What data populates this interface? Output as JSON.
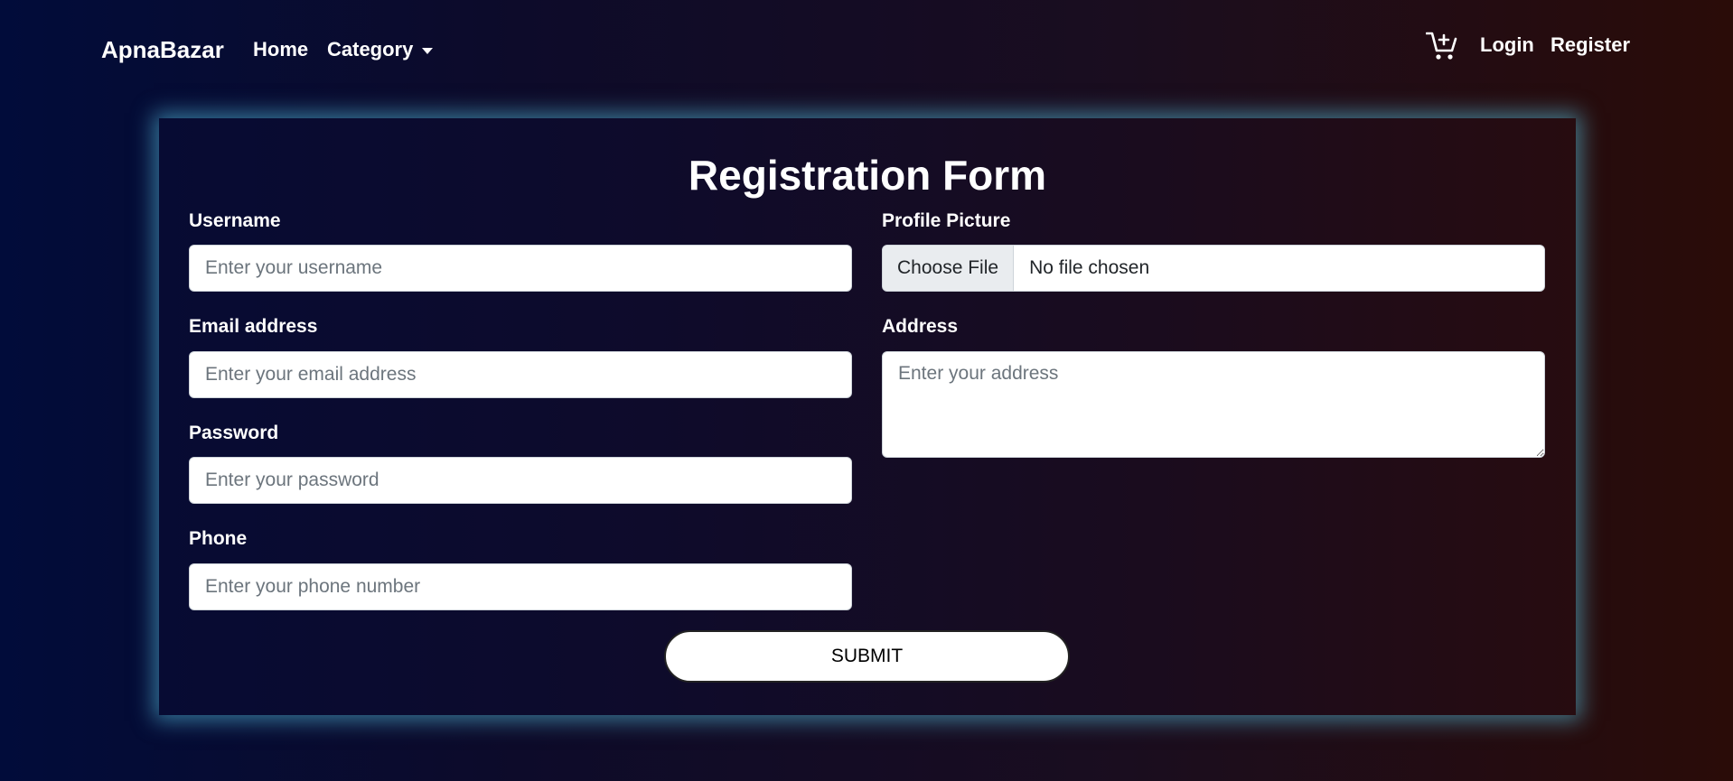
{
  "navbar": {
    "brand": "ApnaBazar",
    "home": "Home",
    "category": "Category",
    "login": "Login",
    "register": "Register",
    "cart_icon": "cart-plus-icon"
  },
  "form": {
    "title": "Registration Form",
    "username": {
      "label": "Username",
      "placeholder": "Enter your username"
    },
    "email": {
      "label": "Email address",
      "placeholder": "Enter your email address"
    },
    "password": {
      "label": "Password",
      "placeholder": "Enter your password"
    },
    "phone": {
      "label": "Phone",
      "placeholder": "Enter your phone number"
    },
    "profile_picture": {
      "label": "Profile Picture",
      "button": "Choose File",
      "status": "No file chosen"
    },
    "address": {
      "label": "Address",
      "placeholder": "Enter your address"
    },
    "submit": "SUBMIT"
  },
  "colors": {
    "accent_glow": "#5ac8e6",
    "bg_left": "#010c3a",
    "bg_right": "#2a0c08"
  }
}
